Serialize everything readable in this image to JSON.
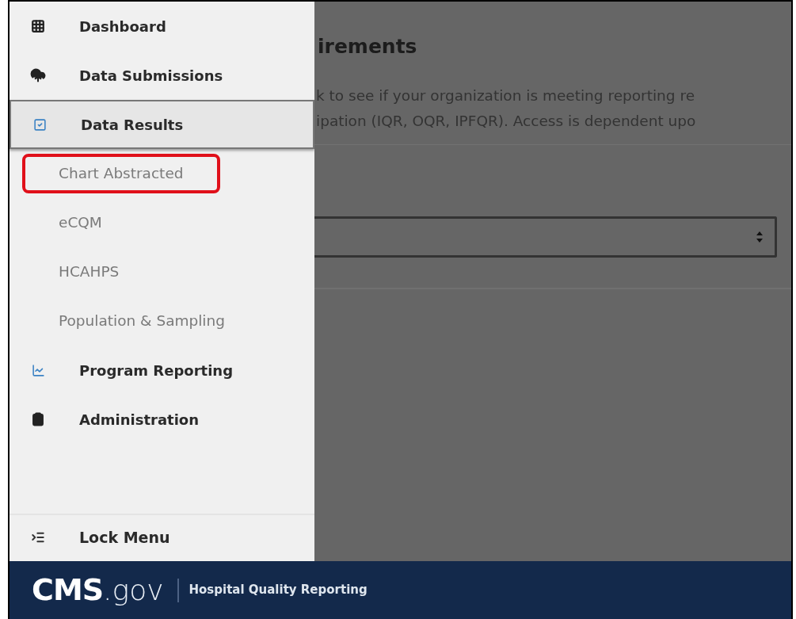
{
  "sidebar": {
    "items": [
      {
        "label": "Dashboard",
        "kind": "grid",
        "selected": false
      },
      {
        "label": "Data Submissions",
        "kind": "cloud",
        "selected": false
      },
      {
        "label": "Data Results",
        "kind": "check",
        "selected": true,
        "children": [
          {
            "label": "Chart Abstracted",
            "selected": false,
            "highlighted": true
          },
          {
            "label": "eCQM",
            "selected": false,
            "highlighted": false
          },
          {
            "label": "HCAHPS",
            "selected": false,
            "highlighted": false
          },
          {
            "label": "Population & Sampling",
            "selected": false,
            "highlighted": false
          }
        ]
      },
      {
        "label": "Program Reporting",
        "kind": "chart",
        "selected": false
      },
      {
        "label": "Administration",
        "kind": "clipboard",
        "selected": false
      }
    ],
    "lock_menu": {
      "label": "Lock Menu",
      "kind": "indent"
    }
  },
  "main": {
    "heading": "irements",
    "description": [
      "k to see if your organization is meeting reporting re",
      "ipation (IQR, OQR, IPFQR). Access is dependent upo"
    ]
  },
  "footer": {
    "logo": "CMS",
    "logo_suffix": ".gov",
    "subtitle": "Hospital Quality Reporting"
  }
}
